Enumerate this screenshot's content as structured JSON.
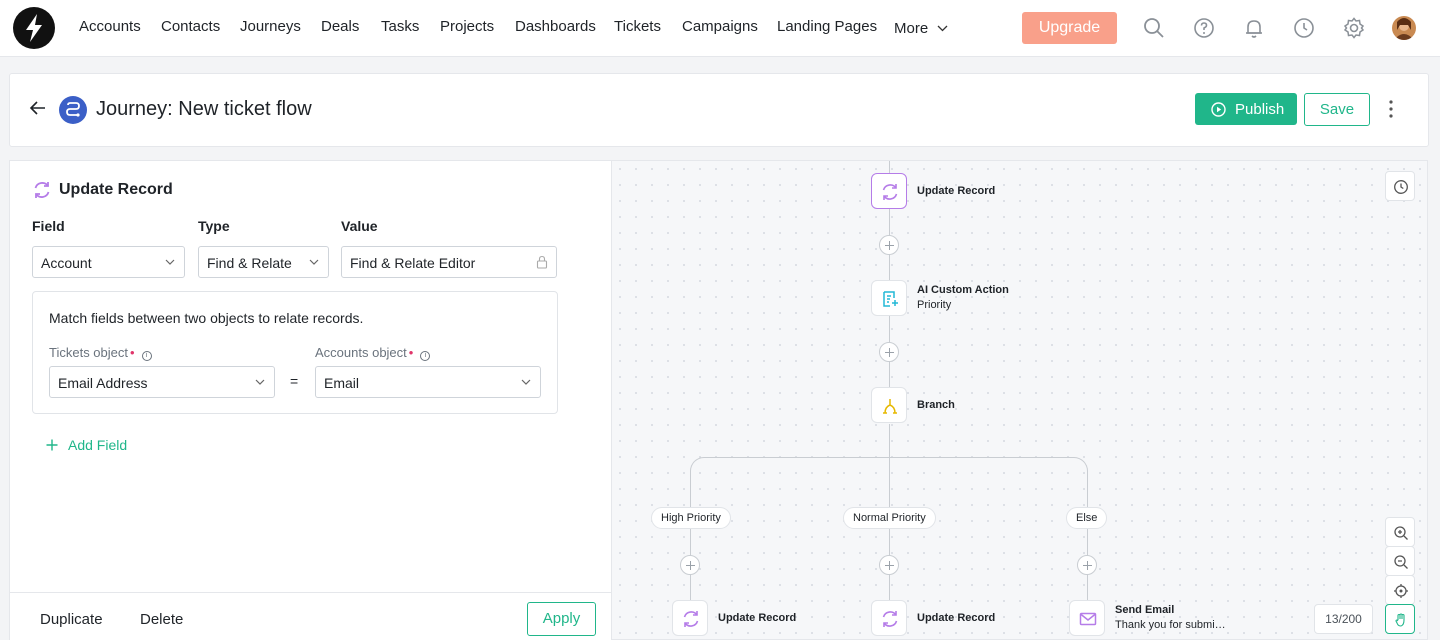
{
  "nav": {
    "items": [
      "Accounts",
      "Contacts",
      "Journeys",
      "Deals",
      "Tasks",
      "Projects",
      "Dashboards",
      "Tickets",
      "Campaigns",
      "Landing Pages",
      "More"
    ],
    "upgrade_label": "Upgrade",
    "icons": [
      "logo-icon",
      "search-icon",
      "help-icon",
      "bell-icon",
      "clock-icon",
      "gear-icon"
    ]
  },
  "header": {
    "title": "Journey: New ticket flow",
    "publish_label": "Publish",
    "save_label": "Save"
  },
  "panel": {
    "title": "Update Record",
    "columns": {
      "field": "Field",
      "type": "Type",
      "value": "Value"
    },
    "field_value": "Account",
    "type_value": "Find & Relate",
    "value_value": "Find & Relate Editor",
    "match": {
      "description": "Match fields between two objects to relate records.",
      "left_label": "Tickets object",
      "right_label": "Accounts object",
      "left_value": "Email Address",
      "right_value": "Email",
      "operator": "="
    },
    "add_field_label": "Add Field",
    "footer": {
      "duplicate": "Duplicate",
      "delete": "Delete",
      "apply": "Apply"
    }
  },
  "canvas": {
    "nodes": {
      "update_top": "Update Record",
      "ai_action": "AI Custom Action",
      "ai_action_sub": "Priority",
      "branch": "Branch",
      "update_high": "Update Record",
      "update_normal": "Update Record",
      "send_email": "Send Email",
      "send_email_sub": "Thank you for submi…"
    },
    "branches": [
      "High Priority",
      "Normal Priority",
      "Else"
    ],
    "counter": "13/200",
    "colors": {
      "accent": "#20b68a",
      "update": "#b57ce8",
      "ai": "#22b8d6",
      "branch": "#e6b800",
      "email": "#b57ce8",
      "upgrade": "#f9a08a"
    }
  }
}
